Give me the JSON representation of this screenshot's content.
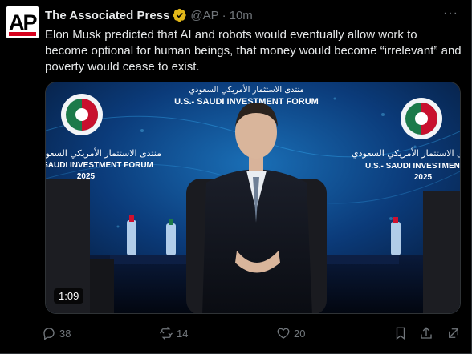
{
  "post": {
    "author_name": "The Associated Press",
    "handle": "@AP",
    "separator": "·",
    "time": "10m",
    "more_label": "···",
    "avatar_text": "AP",
    "text": "Elon Musk predicted that AI and robots would eventually allow work to become optional for human beings, that money would become “irrelevant” and poverty would cease to exist."
  },
  "video": {
    "duration": "1:09",
    "banner_en": "U.S.- SAUDI INVESTMENT FORUM",
    "banner_ar": "منتدى الاستثمار الأمريكي السعودي",
    "left_ar": "منتدى الاستثمار الأمريكي السعودي",
    "left_en": "SAUDI INVESTMENT FORUM",
    "left_year": "2025",
    "right_ar": "منتدى الاستثمار الأمريكي السعودي",
    "right_en": "U.S.- SAUDI INVESTMENT",
    "right_year": "2025"
  },
  "actions": {
    "replies": "38",
    "reposts": "14",
    "likes": "20"
  },
  "colors": {
    "background": "#000000",
    "text": "#e7e9ea",
    "muted": "#71767b",
    "verified": "#e2b719",
    "ap_red": "#d6001c"
  }
}
